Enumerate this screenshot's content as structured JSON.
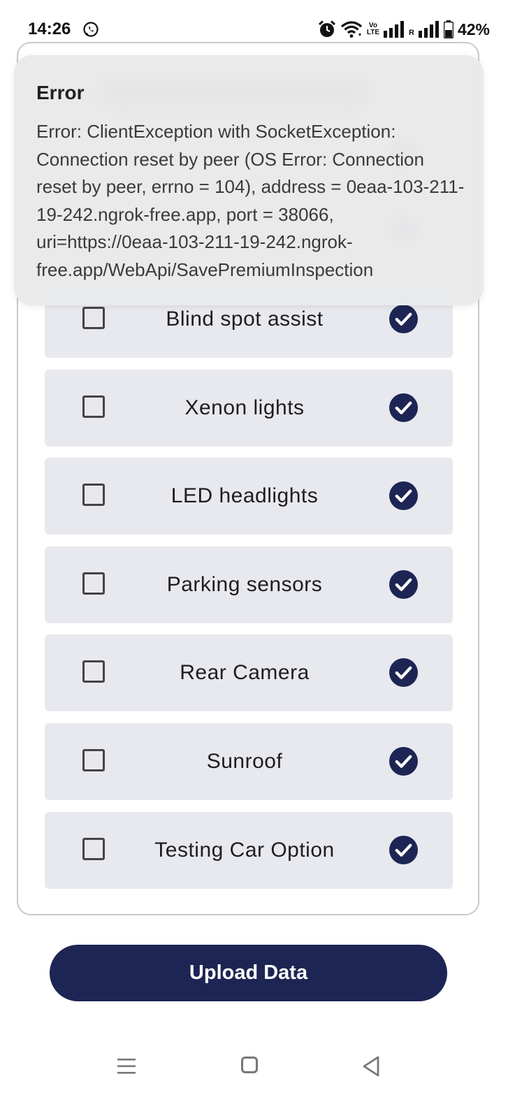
{
  "status_bar": {
    "time": "14:26",
    "battery": "42%",
    "volte": "Vo\nLTE",
    "roaming": "R",
    "icons": [
      "whatsapp-icon",
      "alarm-icon",
      "wifi-icon",
      "volte-icon",
      "signal-icon",
      "signal-roaming-icon",
      "battery-icon"
    ]
  },
  "error_toast": {
    "title": "Error",
    "message": "Error: ClientException with SocketException: Connection reset by peer (OS Error: Connection reset by peer, errno = 104), address = 0eaa-103-211-19-242.ngrok-free.app, port = 38066, uri=https://0eaa-103-211-19-242.ngrok-free.app/WebApi/SavePremiumInspection"
  },
  "options": [
    {
      "label": "Blind spot assist",
      "checked": false,
      "verified": true
    },
    {
      "label": "Xenon lights",
      "checked": false,
      "verified": true
    },
    {
      "label": "LED headlights",
      "checked": false,
      "verified": true
    },
    {
      "label": "Parking sensors",
      "checked": false,
      "verified": true
    },
    {
      "label": "Rear Camera",
      "checked": false,
      "verified": true
    },
    {
      "label": "Sunroof",
      "checked": false,
      "verified": true
    },
    {
      "label": "Testing Car Option",
      "checked": false,
      "verified": true
    }
  ],
  "upload_button": {
    "label": "Upload Data"
  },
  "colors": {
    "accent": "#1d2554",
    "row_background": "#e8e9ef",
    "toast_background": "#e9e9ea"
  }
}
